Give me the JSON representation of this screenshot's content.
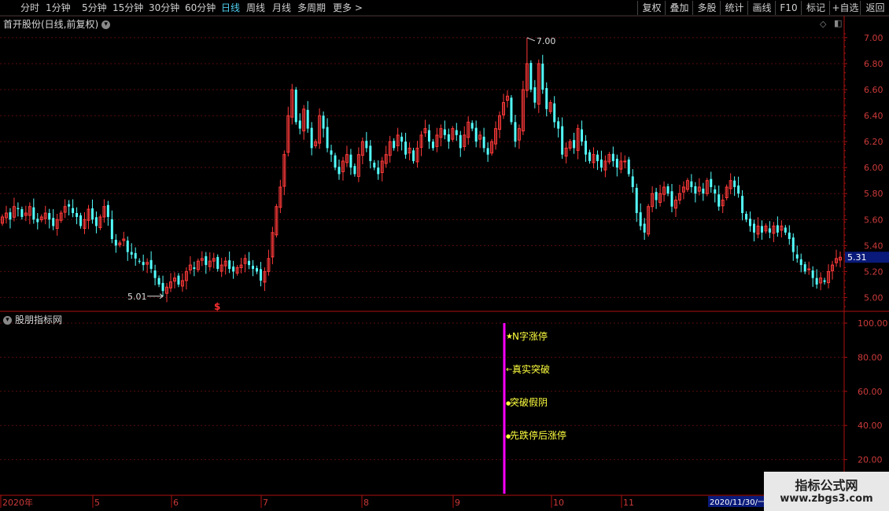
{
  "toolbar": {
    "periods": [
      "分时",
      "1分钟",
      "5分钟",
      "15分钟",
      "30分钟",
      "60分钟",
      "日线",
      "周线",
      "月线",
      "多周期",
      "更多 >"
    ],
    "active_period": "日线",
    "right_buttons": [
      "复权",
      "叠加",
      "多股",
      "统计",
      "画线",
      "F10",
      "标记",
      "+自选",
      "返回"
    ]
  },
  "main_chart": {
    "title": "首开股份(日线,前复权)",
    "price_label": "5.31",
    "high_label": "7.00",
    "low_label": "5.01",
    "marker": "$"
  },
  "indicator": {
    "title": "股朋指标网",
    "signals": [
      "N字涨停",
      "真实突破",
      "突破假阴",
      "先跌停后涨停"
    ],
    "signal_icons": [
      "star-icon",
      "arrow-left-icon",
      "dot-icon",
      "dot-icon"
    ]
  },
  "date_axis": {
    "labels": [
      "2020年",
      "5",
      "6",
      "7",
      "8",
      "9",
      "10",
      "11"
    ],
    "cursor_date": "2020/11/30/一"
  },
  "watermark": {
    "line1": "指标公式网",
    "line2": "www.zbgs3.com"
  },
  "chart_data": [
    {
      "type": "candlestick",
      "title": "首开股份(日线,前复权)",
      "y_ticks": [
        5.0,
        5.2,
        5.4,
        5.6,
        5.8,
        6.0,
        6.2,
        6.4,
        6.6,
        6.8,
        7.0
      ],
      "ylim": [
        4.93,
        7.06
      ],
      "x_ticks": [
        "2020年",
        "5",
        "6",
        "7",
        "8",
        "9",
        "10",
        "11"
      ],
      "grid": true,
      "colors": {
        "up": "#ff3a3a",
        "down": "#54ffff"
      },
      "close": [
        5.62,
        5.65,
        5.6,
        5.7,
        5.68,
        5.62,
        5.65,
        5.7,
        5.6,
        5.58,
        5.62,
        5.65,
        5.6,
        5.55,
        5.6,
        5.65,
        5.7,
        5.7,
        5.65,
        5.62,
        5.55,
        5.6,
        5.68,
        5.6,
        5.55,
        5.62,
        5.7,
        5.62,
        5.45,
        5.4,
        5.42,
        5.45,
        5.35,
        5.33,
        5.3,
        5.28,
        5.25,
        5.27,
        5.22,
        5.15,
        5.1,
        5.05,
        5.08,
        5.12,
        5.15,
        5.1,
        5.13,
        5.2,
        5.25,
        5.22,
        5.28,
        5.3,
        5.25,
        5.28,
        5.3,
        5.22,
        5.25,
        5.28,
        5.22,
        5.2,
        5.23,
        5.25,
        5.3,
        5.25,
        5.22,
        5.2,
        5.13,
        5.2,
        5.3,
        5.5,
        5.7,
        5.85,
        6.1,
        6.4,
        6.6,
        6.35,
        6.3,
        6.45,
        6.3,
        6.15,
        6.2,
        6.4,
        6.3,
        6.15,
        6.1,
        6.0,
        5.95,
        6.05,
        6.1,
        6.0,
        5.95,
        6.1,
        6.2,
        6.15,
        6.05,
        6.0,
        5.95,
        6.05,
        6.1,
        6.2,
        6.15,
        6.25,
        6.2,
        6.1,
        6.15,
        6.05,
        6.15,
        6.25,
        6.3,
        6.2,
        6.15,
        6.25,
        6.3,
        6.25,
        6.2,
        6.3,
        6.25,
        6.15,
        6.25,
        6.35,
        6.3,
        6.2,
        6.25,
        6.15,
        6.1,
        6.2,
        6.3,
        6.4,
        6.5,
        6.55,
        6.35,
        6.2,
        6.3,
        6.6,
        6.8,
        6.6,
        6.5,
        6.8,
        6.6,
        6.45,
        6.5,
        6.35,
        6.3,
        6.1,
        6.15,
        6.2,
        6.15,
        6.3,
        6.2,
        6.1,
        6.05,
        6.1,
        6.05,
        6.0,
        6.05,
        6.1,
        6.05,
        6.0,
        6.05,
        6.05,
        5.95,
        5.85,
        5.65,
        5.55,
        5.5,
        5.7,
        5.8,
        5.75,
        5.8,
        5.85,
        5.8,
        5.7,
        5.75,
        5.8,
        5.85,
        5.9,
        5.85,
        5.8,
        5.85,
        5.8,
        5.9,
        5.85,
        5.8,
        5.7,
        5.75,
        5.85,
        5.9,
        5.85,
        5.8,
        5.65,
        5.6,
        5.55,
        5.5,
        5.55,
        5.5,
        5.55,
        5.5,
        5.55,
        5.5,
        5.55,
        5.5,
        5.45,
        5.35,
        5.3,
        5.25,
        5.2,
        5.22,
        5.15,
        5.1,
        5.15,
        5.12,
        5.2,
        5.25,
        5.3,
        5.31
      ]
    },
    {
      "type": "signal",
      "title": "股朋指标网",
      "y_ticks": [
        20.0,
        40.0,
        60.0,
        80.0,
        100.0
      ],
      "ylim": [
        0,
        106
      ],
      "signal_value": 100,
      "color": "#ff00ff"
    }
  ]
}
